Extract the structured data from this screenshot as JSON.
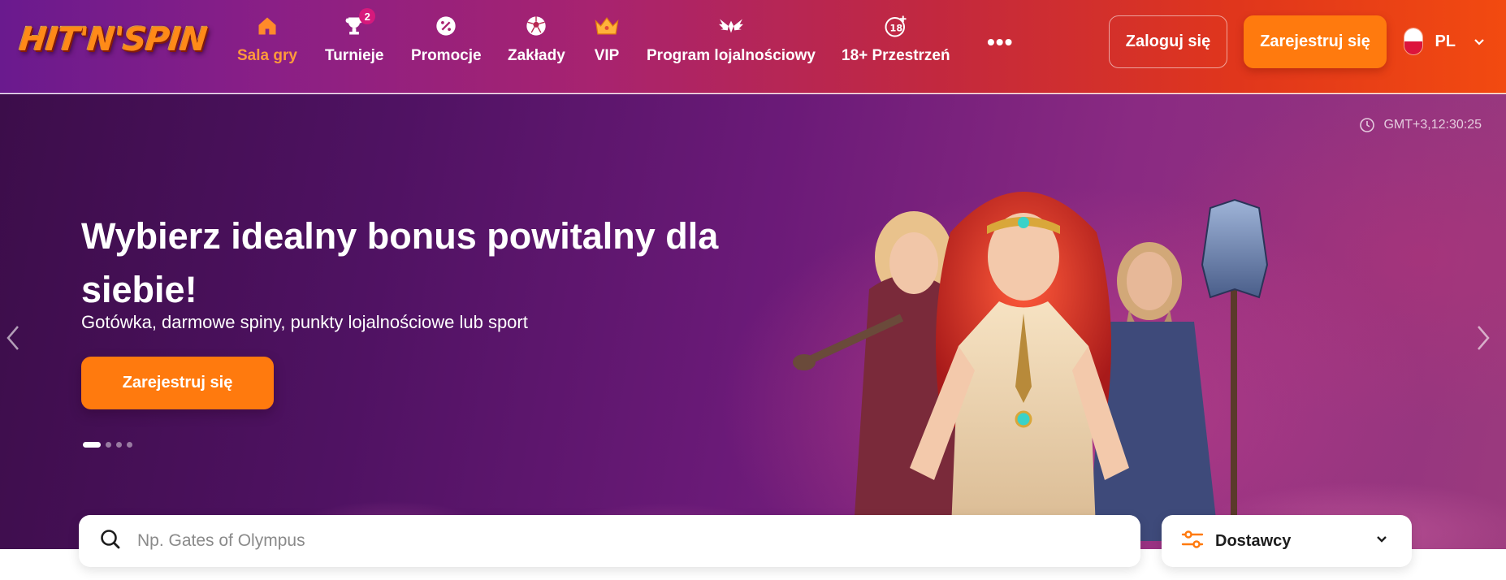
{
  "brand": {
    "logo_text": "HIT'N'SPIN"
  },
  "nav": {
    "items": [
      {
        "label": "Sala gry",
        "icon": "home-icon",
        "active": true
      },
      {
        "label": "Turnieje",
        "icon": "trophy-icon",
        "badge": "2"
      },
      {
        "label": "Promocje",
        "icon": "percent-badge-icon"
      },
      {
        "label": "Zakłady",
        "icon": "soccer-ball-icon"
      },
      {
        "label": "VIP",
        "icon": "crown-icon"
      },
      {
        "label": "Program lojalnościowy",
        "icon": "winged-emblem-icon"
      },
      {
        "label": "18+ Przestrzeń",
        "icon": "age-18-plus-icon"
      }
    ],
    "more": "•••"
  },
  "header": {
    "login_label": "Zaloguj się",
    "register_label": "Zarejestruj się",
    "language": "PL"
  },
  "hero": {
    "clock": "GMT+3,12:30:25",
    "title": "Wybierz idealny bonus powitalny dla siebie!",
    "subtitle": "Gotówka, darmowe spiny, punkty lojalnościowe lub sport",
    "cta_label": "Zarejestruj się",
    "slides_total": 4,
    "active_slide": 1
  },
  "search": {
    "placeholder": "Np. Gates of Olympus",
    "value": ""
  },
  "providers": {
    "label": "Dostawcy"
  },
  "colors": {
    "accent_orange": "#ff7a0e",
    "active_nav": "#ff9a3a",
    "badge": "#d6197c"
  }
}
